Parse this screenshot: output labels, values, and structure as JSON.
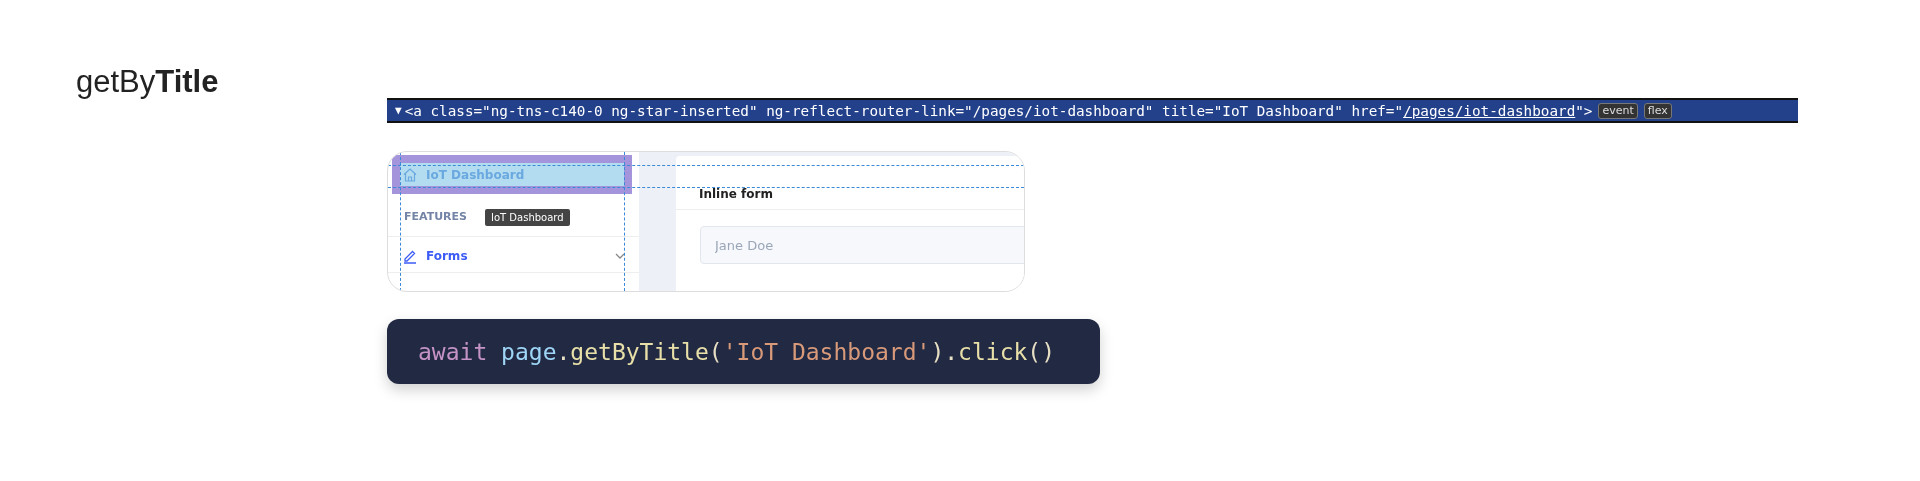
{
  "heading": "getBy**Title**",
  "devtools": {
    "toggle": "▼",
    "markup": "<a class=\"ng-tns-c140-0 ng-star-inserted\" ng-reflect-router-link=\"/pages/iot-dashboard\" title=\"IoT Dashboard\" href=\"",
    "link": "/pages/iot-dashboard",
    "close": "\">",
    "badges": [
      "event",
      "flex"
    ]
  },
  "preview": {
    "sidebar": [
      {
        "kind": "item",
        "label": "IoT Dashboard",
        "selected": true
      },
      {
        "kind": "section",
        "label": "FEATURES"
      },
      {
        "kind": "item",
        "label": "Forms",
        "selected": false,
        "expandable": true
      }
    ],
    "tooltip": "IoT Dashboard",
    "card_title": "Inline form",
    "input": {
      "placeholder": "Jane Doe"
    }
  },
  "code": [
    {
      "kind": "keyword",
      "text": "await "
    },
    {
      "kind": "object",
      "text": "page"
    },
    {
      "kind": "punct",
      "text": "."
    },
    {
      "kind": "method",
      "text": "getByTitle"
    },
    {
      "kind": "punct",
      "text": "("
    },
    {
      "kind": "string",
      "text": "'IoT Dashboard'"
    },
    {
      "kind": "punct",
      "text": ")."
    },
    {
      "kind": "method",
      "text": "click"
    },
    {
      "kind": "punct",
      "text": "()"
    }
  ]
}
